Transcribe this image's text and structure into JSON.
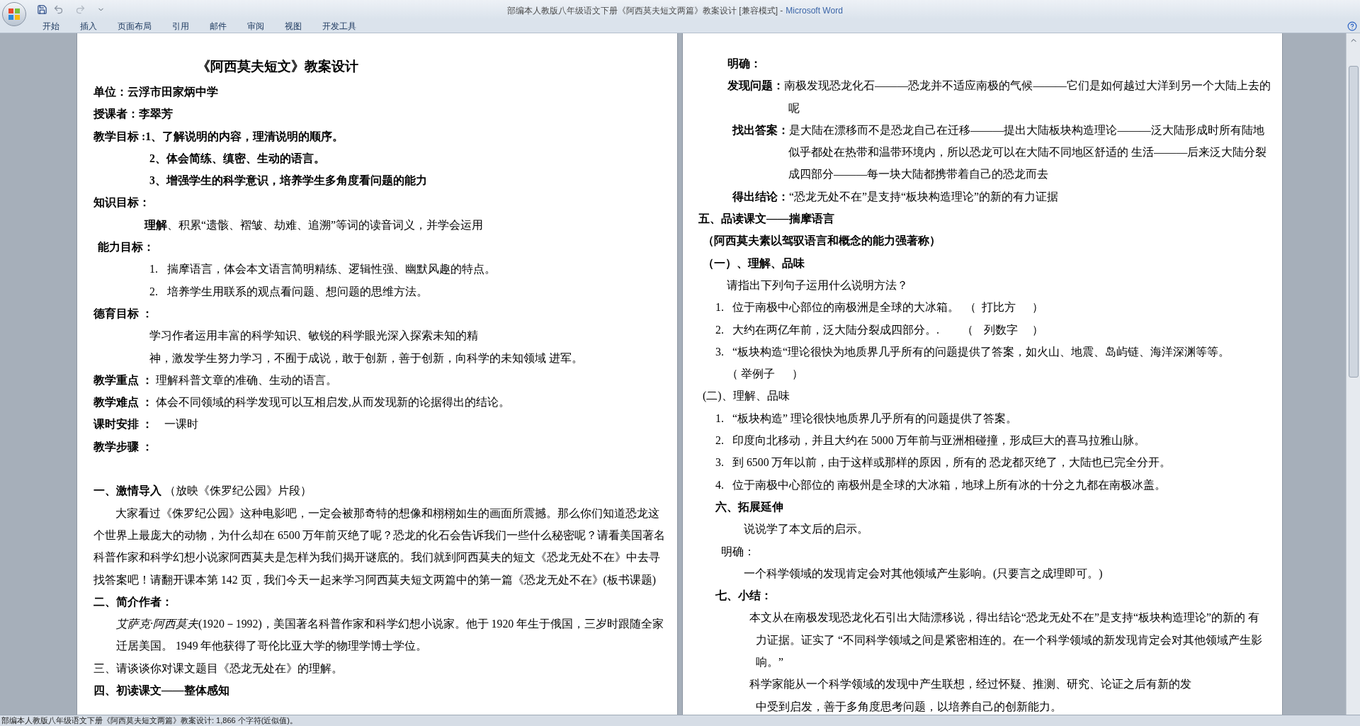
{
  "window": {
    "title": "部编本人教版八年级语文下册《阿西莫夫短文两篇》教案设计 [兼容模式] -",
    "app": "Microsoft Word"
  },
  "ribbon_tabs": [
    "开始",
    "插入",
    "页面布局",
    "引用",
    "邮件",
    "审阅",
    "视图",
    "开发工具"
  ],
  "pages": [
    {
      "lines": [
        {
          "kind": "title",
          "text": "《阿西莫夫短文》教案设计"
        },
        {
          "kind": "heading",
          "text": "单位：云浮市田家炳中学"
        },
        {
          "kind": "heading",
          "text": "授课者：李翠芳"
        },
        {
          "kind": "heading",
          "text": "教学目标 :1、了解说明的内容，理清说明的顺序。"
        },
        {
          "kind": "goal",
          "text": "2、体会简练、缜密、生动的语言。"
        },
        {
          "kind": "goal",
          "text": "3、增强学生的科学意识，培养学生多角度看问题的能力"
        },
        {
          "kind": "heading",
          "text": "知识目标："
        },
        {
          "kind": "knowledge",
          "text": "**理解**、积累“遗骸、褶皱、劫难、追溯”等词的读音词义，并学会运用"
        },
        {
          "kind": "heading-inset",
          "text": "能力目标："
        },
        {
          "kind": "list-item",
          "number": "1.",
          "text": "揣摩语言，体会本文语言简明精练、逻辑性强、幽默风趣的特点。"
        },
        {
          "kind": "list-item",
          "number": "2.",
          "text": "培养学生用联系的观点看问题、想问题的思维方法。"
        },
        {
          "kind": "heading",
          "text": "德育目标 ："
        },
        {
          "kind": "moral",
          "lines": [
            "学习作者运用丰富的科学知识、敏锐的科学眼光深入探索未知的精",
            "神，激发学生努力学习，不囿于成说，敢于创新，善于创新，向科学的未知领域 进军。"
          ]
        },
        {
          "kind": "plain",
          "text": "**教学重点 ：** 理解科普文章的准确、生动的语言。"
        },
        {
          "kind": "plain",
          "text": "**教学难点 ：** 体会不同领域的科学发现可以互相启发,从而发现新的论据得出的结论。"
        },
        {
          "kind": "plain",
          "text": "**课时安排 ：**    一课时"
        },
        {
          "kind": "heading",
          "text": "教学步骤 ："
        },
        {
          "kind": "blank"
        },
        {
          "kind": "plain",
          "text": "**一、激情导入** （放映《侏罗纪公园》片段）"
        },
        {
          "kind": "para",
          "lines": [
            "大家看过《侏罗纪公园》这种电影吧，一定会被那奇特的想像和栩栩如生的画面所震撼。那么你们知道恐龙这",
            "个世界上最庞大的动物，为什么却在 6500 万年前灭绝了呢？恐龙的化石会告诉我们一些什么秘密呢？请看美国著名",
            "科普作家和科学幻想小说家阿西莫夫是怎样为我们揭开谜底的。我们就到阿西莫夫的短文《恐龙无处不在》中去寻",
            "找答案吧！请翻开课本第 142 页，我们今天一起来学习阿西莫夫短文两篇中的第一篇《恐龙无处不在》(板书课题)"
          ]
        },
        {
          "kind": "heading",
          "text": "二、简介作者："
        },
        {
          "kind": "para-inset",
          "lines": [
            "*艾萨克·阿西莫夫*(1920－1992)，美国著名科普作家和科学幻想小说家。他于 1920 年生于俄国，三岁时跟随全家",
            "迁居美国。 1949 年他获得了哥伦比亚大学的物理学博士学位。"
          ]
        },
        {
          "kind": "plain",
          "text": "三、请谈谈你对课文题目《恐龙无处在》的理解。"
        },
        {
          "kind": "heading",
          "text": "四、初读课文——整体感知"
        }
      ]
    },
    {
      "lines": [
        {
          "kind": "answer-label",
          "text": "明确："
        },
        {
          "kind": "hanging",
          "lines": [
            "**发现问题：**南极发现恐龙化石———恐龙并不适应南极的气候———它们是如何越过大洋到另一个大陆上去的",
            "呢"
          ]
        },
        {
          "kind": "hanging-deep",
          "lines": [
            "**找出答案：**是大陆在漂移而不是恐龙自己在迁移———提出大陆板块构造理论———泛大陆形成时所有陆地",
            "似乎都处在热带和温带环境内，所以恐龙可以在大陆不同地区舒适的 生活———后来泛大陆分裂",
            "成四部分———每一块大陆都携带着自己的恐龙而去"
          ]
        },
        {
          "kind": "conclusion",
          "text": "**得出结论：**“恐龙无处不在”是支持“板块构造理论”的新的有力证据"
        },
        {
          "kind": "heading",
          "text": "五、品读课文——揣摩语言"
        },
        {
          "kind": "heading-inset",
          "text": "（阿西莫夫素以驾驭语言和概念的能力强著称）"
        },
        {
          "kind": "heading-inset",
          "text": "（一）、理解、品味"
        },
        {
          "kind": "prompt",
          "text": "请指出下列句子运用什么说明方法？"
        },
        {
          "kind": "item",
          "number": "1.",
          "text": "位于南极中心部位的南极洲是全球的大冰箱。  （  打比方      ）"
        },
        {
          "kind": "item",
          "number": "2.",
          "text": "大约在两亿年前，泛大陆分裂成四部分。.        （    列数字     ）"
        },
        {
          "kind": "item",
          "number": "3.",
          "text": "“板块构造“理论很快为地质界几乎所有的问题提供了答案，如火山、地震、岛屿链、海洋深渊等等。"
        },
        {
          "kind": "prompt",
          "text": "（ 举例子      ）"
        },
        {
          "kind": "subheading",
          "text": "(二)、理解、品味"
        },
        {
          "kind": "item",
          "number": "1.",
          "text": "“板块构造” 理论很快地质界几乎所有的问题提供了答案。"
        },
        {
          "kind": "item",
          "number": "2.",
          "text": "印度向北移动，并且大约在 5000 万年前与亚洲相碰撞，形成巨大的喜马拉雅山脉。"
        },
        {
          "kind": "item",
          "number": "3.",
          "text": "到 6500 万年以前，由于这样或那样的原因，所有的 恐龙都灭绝了，大陆也已完全分开。"
        },
        {
          "kind": "item",
          "number": "4.",
          "text": "位于南极中心部位的 南极州是全球的大冰箱，地球上所有冰的十分之九都在南极冰盖。"
        },
        {
          "kind": "section",
          "text": "六、拓展延伸"
        },
        {
          "kind": "indent",
          "text": "说说学了本文后的启示。"
        },
        {
          "kind": "note",
          "text": "明确："
        },
        {
          "kind": "indent",
          "text": "一个科学领域的发现肯定会对其他领域产生影响。(只要言之成理即可。)"
        },
        {
          "kind": "section",
          "text": "七、小结："
        },
        {
          "kind": "summary",
          "lines": [
            "本文从在南极发现恐龙化石引出大陆漂移说，得出结论“恐龙无处不在”是支持“板块构造理论”的新的 有",
            "力证据。证实了 “不同科学领域之间是紧密相连的。在一个科学领域的新发现肯定会对其他领域产生影",
            "响。”"
          ]
        },
        {
          "kind": "summary",
          "lines": [
            "科学家能从一个科学领域的发现中产生联想，经过怀疑、推测、研究、论证之后有新的发",
            "中受到启发，善于多角度思考问题，以培养自己的创新能力。"
          ]
        }
      ]
    }
  ],
  "status_bar": "部编本人教版八年级语文下册《阿西莫夫短文两篇》教案设计: 1,866 个字符(近似值)。"
}
